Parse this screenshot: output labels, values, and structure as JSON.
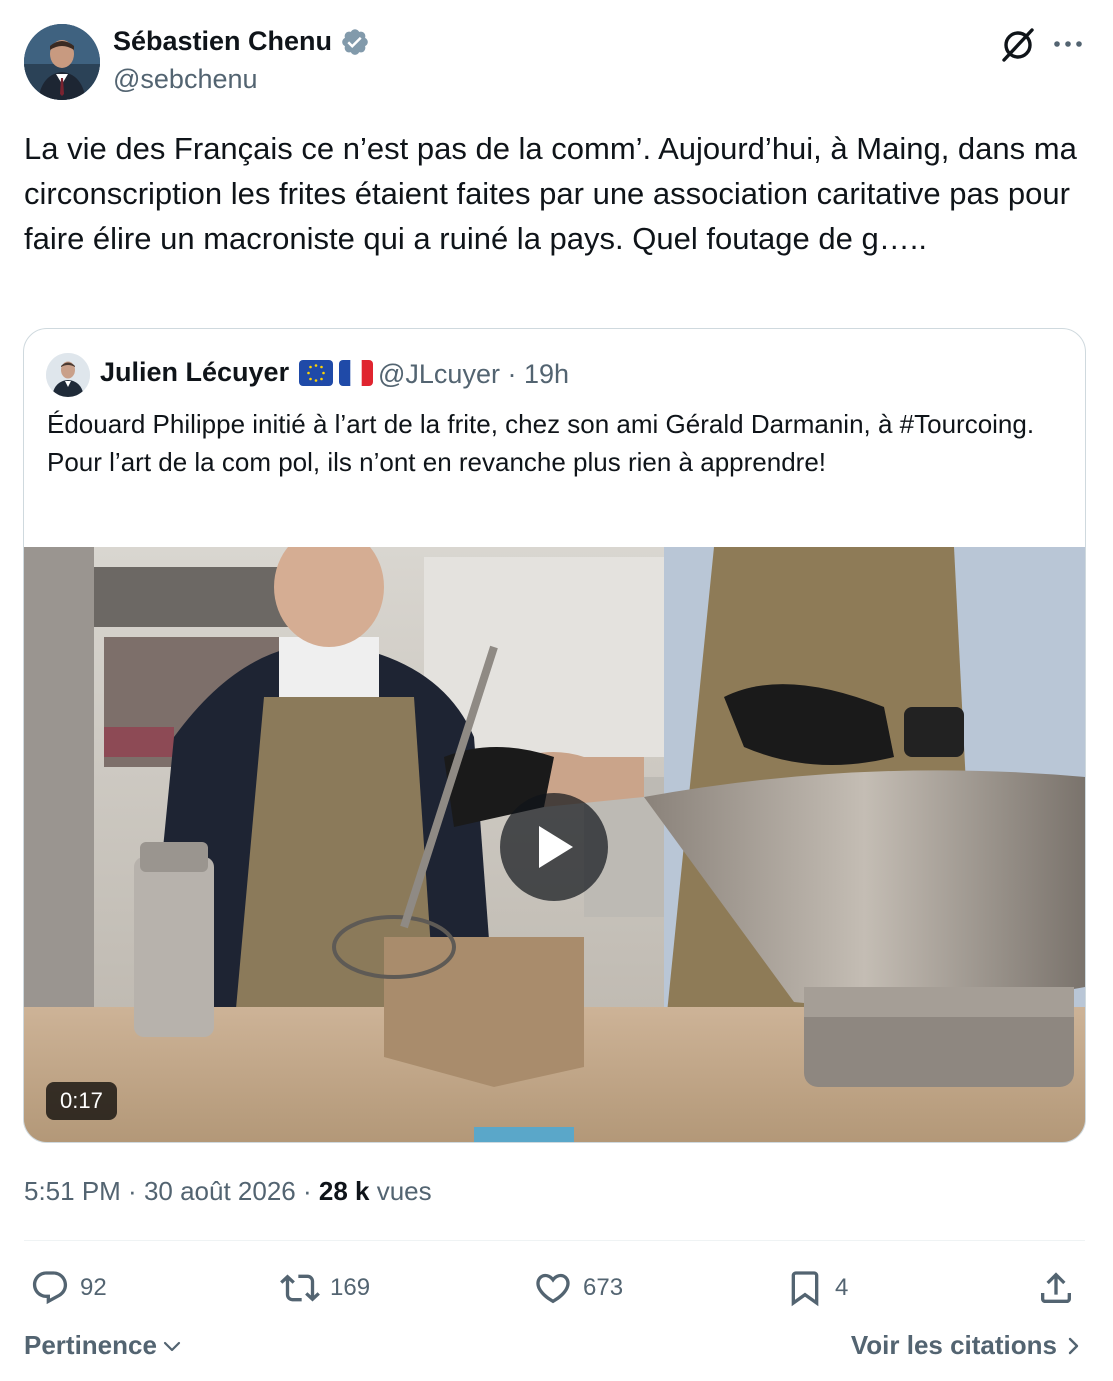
{
  "tweet": {
    "author_name": "Sébastien Chenu",
    "handle": "@sebchenu",
    "text": "La vie des Français ce n’est pas de la comm’. Aujourd’hui, à Maing, dans ma circonscription les frites étaient faites par une association caritative pas pour faire élire un macroniste qui a ruiné la pays. Quel foutage de g…..",
    "time": "5:51 PM",
    "sep1": " · ",
    "date": "30 août 2026",
    "sep2": " · ",
    "views_count": "28 k",
    "views_label": " vues"
  },
  "quoted": {
    "author_name": "Julien Lécuyer",
    "handle": "@JLcuyer",
    "age": "19h",
    "meta_sep": " · ",
    "text": "Édouard Philippe initié à l’art de la frite, chez son ami Gérald Darmanin, à #Tourcoing. Pour l’art de la com pol, ils n’ont en revanche plus rien à apprendre!",
    "video_duration": "0:17"
  },
  "actions": {
    "replies": "92",
    "reposts": "169",
    "likes": "673",
    "bookmarks": "4"
  },
  "footer": {
    "sort_label": "Pertinence",
    "citations_label": "Voir les citations"
  },
  "icons": [
    "verified-badge-icon",
    "grok-icon",
    "more-icon",
    "play-icon",
    "reply-icon",
    "repost-icon",
    "like-icon",
    "bookmark-icon",
    "share-icon",
    "chevron-down-icon",
    "chevron-right-icon",
    "eu-flag-icon",
    "fr-flag-icon"
  ],
  "colors": {
    "text": "#0f1419",
    "secondary": "#536471",
    "verified": "#829aab",
    "border": "#cfd9de"
  }
}
